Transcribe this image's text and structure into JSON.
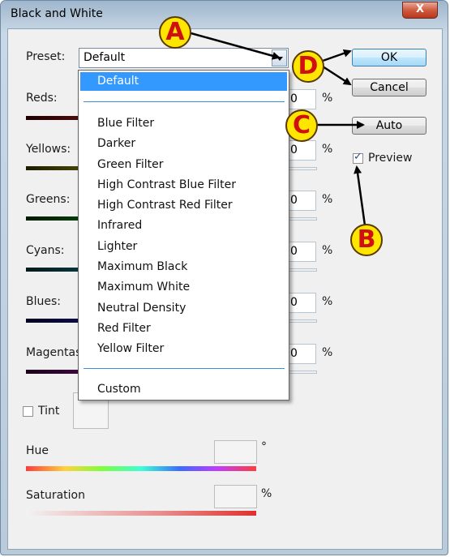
{
  "window": {
    "title": "Black and White",
    "close_glyph": "X"
  },
  "preset": {
    "label": "Preset:",
    "value": "Default"
  },
  "buttons": {
    "ok": "OK",
    "cancel": "Cancel",
    "auto": "Auto"
  },
  "preview": {
    "label": "Preview",
    "checked": true
  },
  "sliders": [
    {
      "label": "Reds:",
      "value": "0",
      "unit": "%"
    },
    {
      "label": "Yellows:",
      "value": "0",
      "unit": "%"
    },
    {
      "label": "Greens:",
      "value": "0",
      "unit": "%"
    },
    {
      "label": "Cyans:",
      "value": "0",
      "unit": "%"
    },
    {
      "label": "Blues:",
      "value": "0",
      "unit": "%"
    },
    {
      "label": "Magentas:",
      "value": "0",
      "unit": "%"
    }
  ],
  "dropdown": {
    "selected": "Default",
    "items": [
      "Blue Filter",
      "Darker",
      "Green Filter",
      "High Contrast Blue Filter",
      "High Contrast Red Filter",
      "Infrared",
      "Lighter",
      "Maximum Black",
      "Maximum White",
      "Neutral Density",
      "Red Filter",
      "Yellow Filter"
    ],
    "custom": "Custom"
  },
  "tint": {
    "label": "Tint",
    "checked": false
  },
  "hue": {
    "label": "Hue",
    "unit": "°"
  },
  "saturation": {
    "label": "Saturation",
    "unit": "%"
  },
  "annotations": {
    "a": "A",
    "b": "B",
    "c": "C",
    "d": "D"
  },
  "colors": {
    "selection": "#3399ff",
    "callout_fill": "#ffe600",
    "callout_text": "#d01010"
  }
}
